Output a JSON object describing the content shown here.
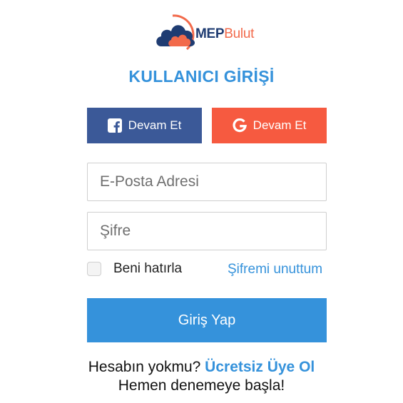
{
  "logo": {
    "mep_text": "MEP",
    "bulut_text": "Bulut",
    "icon": "cloud-icon",
    "colors": {
      "dark": "#1f3c72",
      "accent": "#f26a4b"
    }
  },
  "header": {
    "title": "KULLANICI GİRİŞİ"
  },
  "social": {
    "facebook": {
      "label": "Devam Et",
      "icon": "facebook-icon",
      "color": "#3b5998"
    },
    "google": {
      "label": "Devam Et",
      "icon": "google-icon",
      "color": "#f65a40"
    }
  },
  "form": {
    "email": {
      "value": "",
      "placeholder": "E-Posta Adresi"
    },
    "password": {
      "value": "",
      "placeholder": "Şifre"
    },
    "remember_label": "Beni hatırla",
    "remember_checked": false,
    "forgot_label": "Şifremi unuttum",
    "submit_label": "Giriş Yap"
  },
  "footer": {
    "question": "Hesabın yokmu?",
    "signup_label": "Ücretsiz Üye Ol",
    "tagline": "Hemen denemeye başla!"
  },
  "colors": {
    "primary": "#3592db",
    "border": "#cfcfcf"
  }
}
